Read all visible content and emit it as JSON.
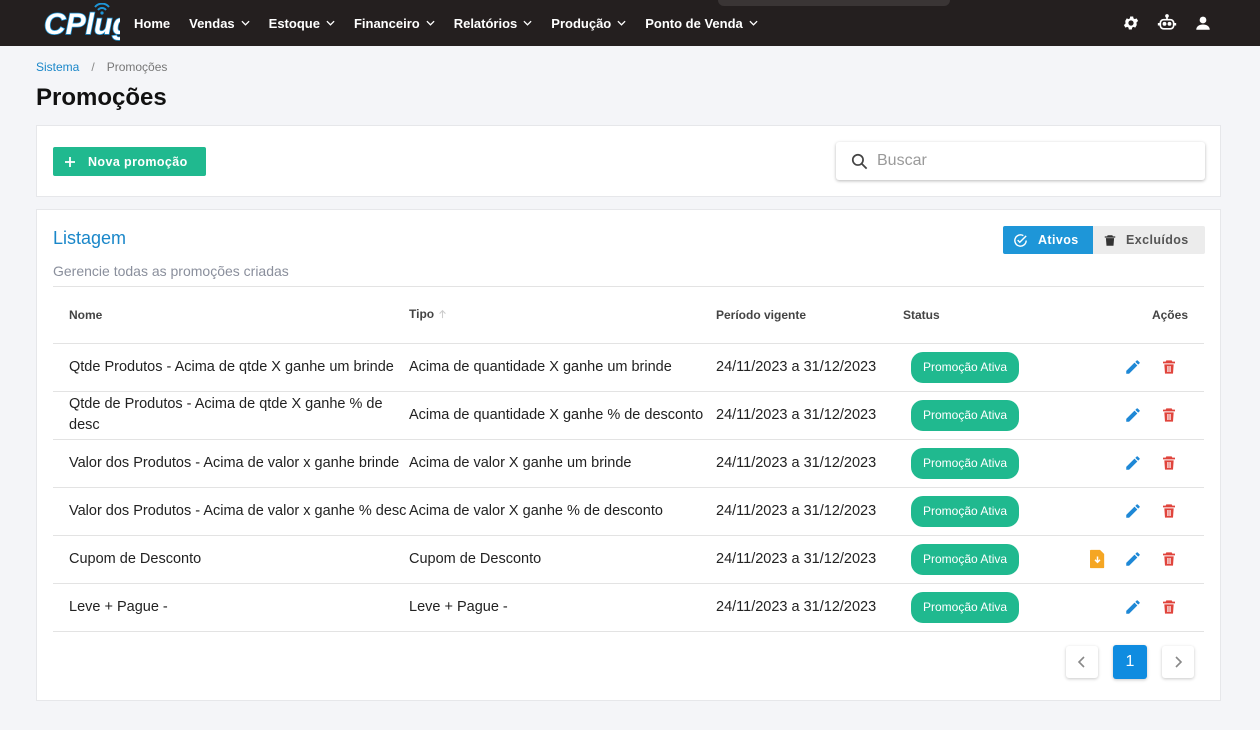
{
  "app": {
    "logo_text": "CPlug"
  },
  "nav": {
    "items": [
      {
        "label": "Home",
        "has_dropdown": false
      },
      {
        "label": "Vendas",
        "has_dropdown": true
      },
      {
        "label": "Estoque",
        "has_dropdown": true
      },
      {
        "label": "Financeiro",
        "has_dropdown": true
      },
      {
        "label": "Relatórios",
        "has_dropdown": true
      },
      {
        "label": "Produção",
        "has_dropdown": true
      },
      {
        "label": "Ponto de Venda",
        "has_dropdown": true
      }
    ],
    "icons": [
      "gear-icon",
      "robot-icon",
      "user-icon"
    ]
  },
  "breadcrumb": {
    "root": "Sistema",
    "separator": "/",
    "current": "Promoções"
  },
  "page": {
    "title": "Promoções"
  },
  "toolbar": {
    "new_button_label": "Nova promoção",
    "search_placeholder": "Buscar",
    "search_value": ""
  },
  "listing": {
    "title": "Listagem",
    "subtitle": "Gerencie todas as promoções criadas",
    "filters": {
      "active_label": "Ativos",
      "deleted_label": "Excluídos",
      "selected": "Ativos"
    },
    "columns": {
      "nome": "Nome",
      "tipo": "Tipo",
      "periodo": "Período vigente",
      "status": "Status",
      "acoes": "Ações"
    },
    "rows": [
      {
        "nome": "Qtde Produtos - Acima de qtde X ganhe um brinde",
        "tipo": "Acima de quantidade X ganhe um brinde",
        "periodo": "24/11/2023 a 31/12/2023",
        "status": "Promoção Ativa",
        "has_download": false
      },
      {
        "nome": "Qtde de Produtos - Acima de qtde X ganhe % de desc",
        "tipo": "Acima de quantidade X ganhe % de desconto",
        "periodo": "24/11/2023 a 31/12/2023",
        "status": "Promoção Ativa",
        "has_download": false
      },
      {
        "nome": "Valor dos Produtos - Acima de valor x ganhe brinde",
        "tipo": "Acima de valor X ganhe um brinde",
        "periodo": "24/11/2023 a 31/12/2023",
        "status": "Promoção Ativa",
        "has_download": false
      },
      {
        "nome": "Valor dos Produtos - Acima de valor x ganhe % desc",
        "tipo": "Acima de valor X ganhe % de desconto",
        "periodo": "24/11/2023 a 31/12/2023",
        "status": "Promoção Ativa",
        "has_download": false
      },
      {
        "nome": "Cupom de Desconto",
        "tipo": "Cupom de Desconto",
        "periodo": "24/11/2023 a 31/12/2023",
        "status": "Promoção Ativa",
        "has_download": true
      },
      {
        "nome": "Leve + Pague -",
        "tipo": "Leve + Pague -",
        "periodo": "24/11/2023 a 31/12/2023",
        "status": "Promoção Ativa",
        "has_download": false
      }
    ]
  },
  "pagination": {
    "current_page": "1"
  },
  "colors": {
    "topbar": "#241f1f",
    "accent_green": "#20b98f",
    "accent_blue": "#1e96d8",
    "link_blue": "#1a87c9",
    "delete_red": "#e0443c",
    "download_orange": "#f5a623"
  }
}
